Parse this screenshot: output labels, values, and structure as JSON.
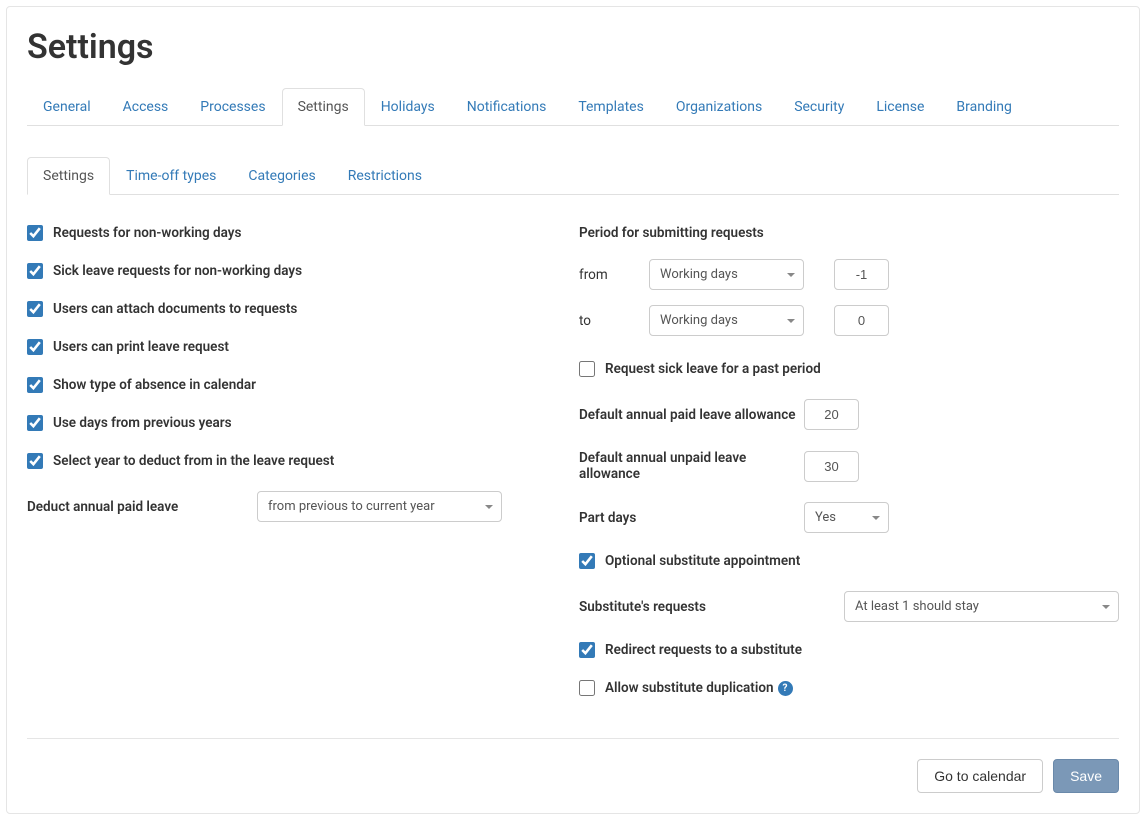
{
  "page_title": "Settings",
  "main_tabs": [
    {
      "label": "General",
      "active": false
    },
    {
      "label": "Access",
      "active": false
    },
    {
      "label": "Processes",
      "active": false
    },
    {
      "label": "Settings",
      "active": true
    },
    {
      "label": "Holidays",
      "active": false
    },
    {
      "label": "Notifications",
      "active": false
    },
    {
      "label": "Templates",
      "active": false
    },
    {
      "label": "Organizations",
      "active": false
    },
    {
      "label": "Security",
      "active": false
    },
    {
      "label": "License",
      "active": false
    },
    {
      "label": "Branding",
      "active": false
    }
  ],
  "sub_tabs": [
    {
      "label": "Settings",
      "active": true
    },
    {
      "label": "Time-off types",
      "active": false
    },
    {
      "label": "Categories",
      "active": false
    },
    {
      "label": "Restrictions",
      "active": false
    }
  ],
  "left": {
    "cb_requests_nonworking": {
      "label": "Requests for non-working days",
      "checked": true
    },
    "cb_sick_nonworking": {
      "label": "Sick leave requests for non-working days",
      "checked": true
    },
    "cb_attach_docs": {
      "label": "Users can attach documents to requests",
      "checked": true
    },
    "cb_print": {
      "label": "Users can print leave request",
      "checked": true
    },
    "cb_show_type": {
      "label": "Show type of absence in calendar",
      "checked": true
    },
    "cb_prev_years": {
      "label": "Use days from previous years",
      "checked": true
    },
    "cb_select_year": {
      "label": "Select year to deduct from in the leave request",
      "checked": true
    },
    "deduct": {
      "label": "Deduct annual paid leave",
      "value": "from previous to current year"
    }
  },
  "right": {
    "period_header": "Period for submitting requests",
    "from_label": "from",
    "to_label": "to",
    "from_unit": "Working days",
    "from_value": "-1",
    "to_unit": "Working days",
    "to_value": "0",
    "cb_sick_past": {
      "label": "Request sick leave for a past period",
      "checked": false
    },
    "paid_allowance": {
      "label": "Default annual paid leave allowance",
      "value": "20"
    },
    "unpaid_allowance": {
      "label": "Default annual unpaid leave allowance",
      "value": "30"
    },
    "part_days": {
      "label": "Part days",
      "value": "Yes"
    },
    "cb_optional_substitute": {
      "label": "Optional substitute appointment",
      "checked": true
    },
    "substitute_requests": {
      "label": "Substitute's requests",
      "value": "At least 1 should stay"
    },
    "cb_redirect": {
      "label": "Redirect requests to a substitute",
      "checked": true
    },
    "cb_allow_dup": {
      "label": "Allow substitute duplication",
      "checked": false
    }
  },
  "footer": {
    "go_to_calendar": "Go to calendar",
    "save": "Save"
  }
}
